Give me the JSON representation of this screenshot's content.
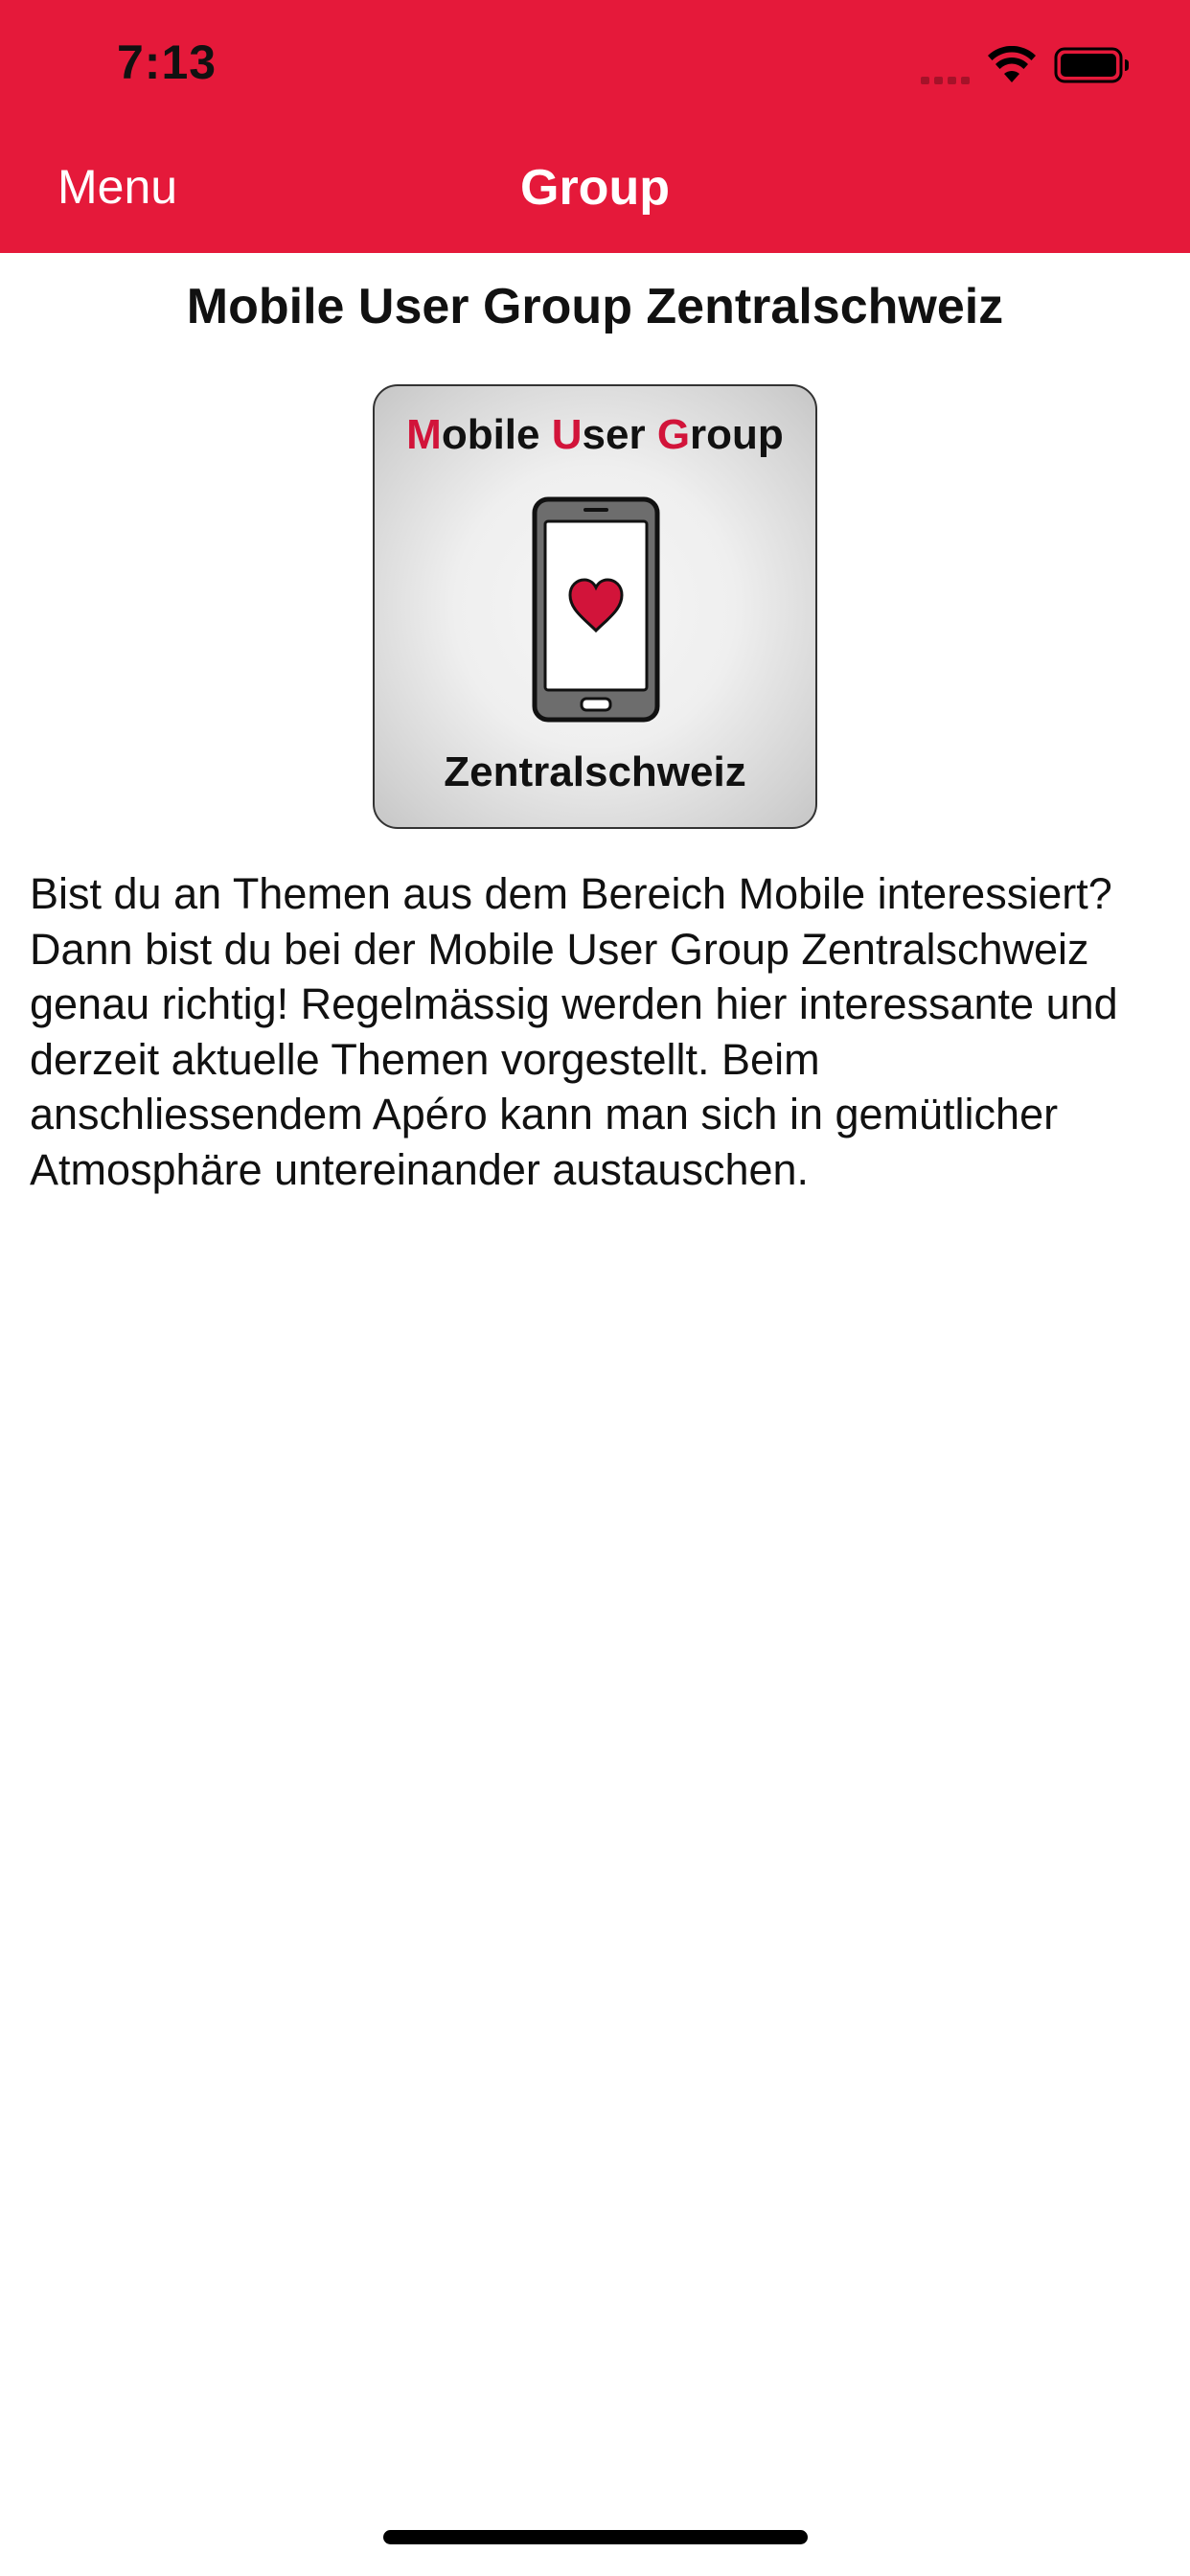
{
  "status_bar": {
    "time": "7:13"
  },
  "nav": {
    "menu_label": "Menu",
    "title": "Group"
  },
  "content": {
    "title": "Mobile User Group Zentralschweiz",
    "logo": {
      "top_text": {
        "m": "M",
        "obile": "obile ",
        "u": "U",
        "ser": "ser ",
        "g": "G",
        "roup": "roup"
      },
      "bottom_text": "Zentralschweiz"
    },
    "description": "Bist du an Themen aus dem Bereich Mobile interessiert? Dann bist du bei der Mobile User Group Zentralschweiz genau richtig! Regelmässig werden hier interessante und derzeit aktuelle Themen vorgestellt. Beim anschliessendem Apéro kann man sich in gemütlicher Atmosphäre untereinander austauschen."
  },
  "colors": {
    "accent": "#e5193a",
    "logo_red": "#d2143a"
  },
  "icons": {
    "signal": "cellular-signal-icon",
    "wifi": "wifi-icon",
    "battery": "battery-icon",
    "phone": "phone-icon",
    "heart": "heart-icon"
  }
}
